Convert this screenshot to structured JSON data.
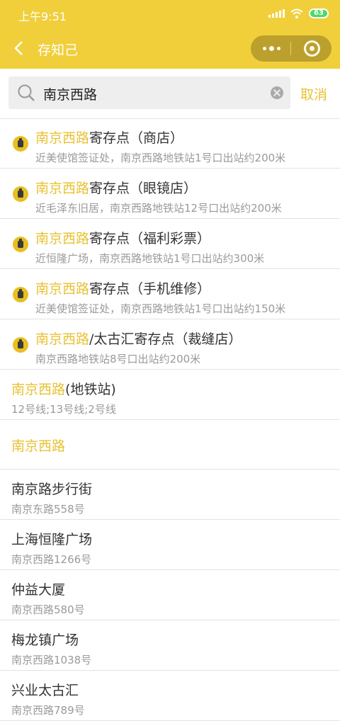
{
  "status_bar": {
    "time": "上午9:51",
    "battery": "63"
  },
  "nav": {
    "title": "存知己"
  },
  "search": {
    "value": "南京西路",
    "cancel_label": "取消"
  },
  "store_results": [
    {
      "highlight": "南京西路",
      "rest": "寄存点（商店）",
      "subtitle": "近美使馆签证处，南京西路地铁站1号口出站约200米"
    },
    {
      "highlight": "南京西路",
      "rest": "寄存点（眼镜店）",
      "subtitle": "近毛泽东旧居，南京西路地铁站12号口出站约200米"
    },
    {
      "highlight": "南京西路",
      "rest": "寄存点（福利彩票）",
      "subtitle": "近恒隆广场，南京西路地铁站1号口出站约300米"
    },
    {
      "highlight": "南京西路",
      "rest": "寄存点（手机维修）",
      "subtitle": "近美使馆签证处，南京西路地铁站1号口出站约150米"
    },
    {
      "highlight": "南京西路",
      "rest": "/太古汇寄存点（裁缝店）",
      "subtitle": "南京西路地铁站8号口出站约200米"
    }
  ],
  "metro_result": {
    "highlight": "南京西路",
    "rest": "(地铁站)",
    "subtitle": "12号线;13号线;2号线"
  },
  "plain_result": {
    "title": "南京西路"
  },
  "place_results": [
    {
      "title": "南京路步行街",
      "subtitle": "南京东路558号"
    },
    {
      "title": "上海恒隆广场",
      "subtitle": "南京西路1266号"
    },
    {
      "title": "仲益大厦",
      "subtitle": "南京西路580号"
    },
    {
      "title": "梅龙镇广场",
      "subtitle": "南京西路1038号"
    },
    {
      "title": "兴业太古汇",
      "subtitle": "南京西路789号"
    }
  ]
}
